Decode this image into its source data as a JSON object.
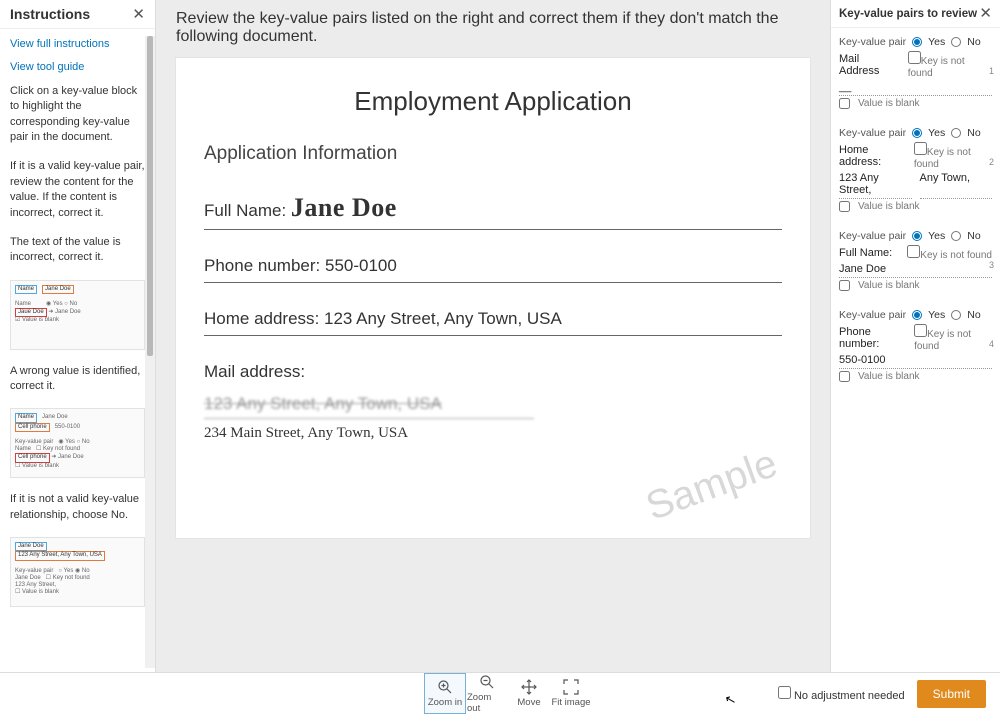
{
  "instructions": {
    "title": "Instructions",
    "link_full": "View full instructions",
    "link_guide": "View tool guide",
    "p1": "Click on a key-value block to highlight the corresponding key-value pair in the document.",
    "p2": "If it is a valid key-value pair, review the content for the value. If the content is incorrect, correct it.",
    "p3": "The text of the value is incorrect, correct it.",
    "p4": "A wrong value is identified, correct it.",
    "p5": "If it is not a valid key-value relationship, choose No."
  },
  "question": "Review the key-value pairs listed on the right and correct them if they don't match the following document.",
  "doc": {
    "title": "Employment Application",
    "section": "Application Information",
    "fullname_label": "Full Name:",
    "fullname_value": "Jane Doe",
    "phone_label": "Phone number",
    "phone_value": "550-0100",
    "home_label": "Home address",
    "home_value": "123 Any Street, Any Town, USA",
    "mail_label": "Mail address:",
    "mail_struck": "123 Any Street, Any Town, USA",
    "mail_hand": "234 Main Street, Any Town, USA",
    "sample": "Sample"
  },
  "review": {
    "title": "Key-value pairs to review",
    "kv_pair_label": "Key-value pair",
    "yes": "Yes",
    "no": "No",
    "key_not_found": "Key is not found",
    "value_blank": "Value is blank",
    "items": [
      {
        "idx": "1",
        "key": "Mail Address",
        "val": "__"
      },
      {
        "idx": "2",
        "key": "Home address:",
        "val_a": "123 Any Street,",
        "val_b": "Any Town,"
      },
      {
        "idx": "3",
        "key": "Full Name:",
        "val": "Jane Doe"
      },
      {
        "idx": "4",
        "key": "Phone number:",
        "val": "550-0100"
      }
    ]
  },
  "tools": {
    "zoom_in": "Zoom in",
    "zoom_out": "Zoom out",
    "move": "Move",
    "fit": "Fit image"
  },
  "footer": {
    "no_adjust": "No adjustment needed",
    "submit": "Submit"
  }
}
